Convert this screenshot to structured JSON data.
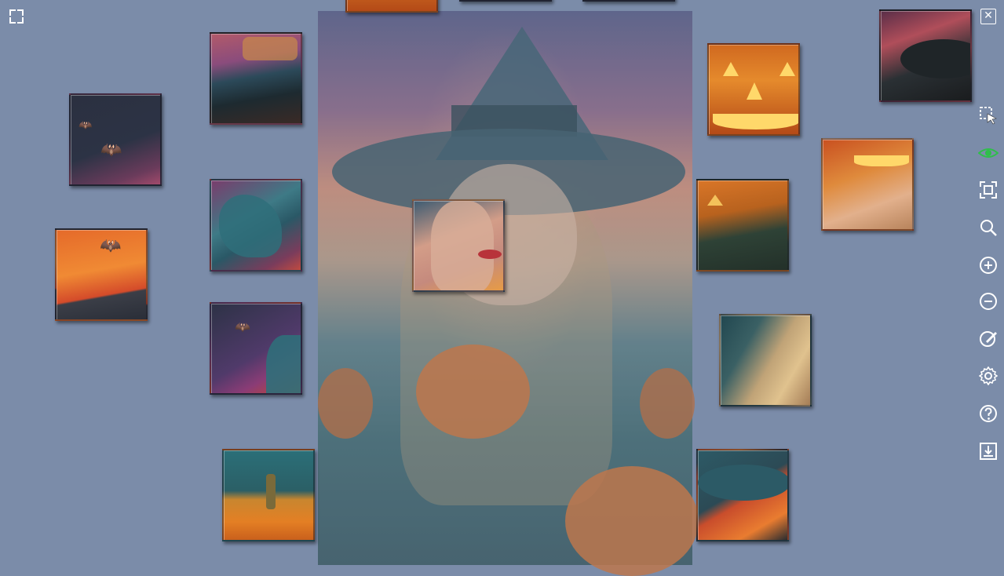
{
  "window": {
    "close_label": "✕"
  },
  "toolbar": {
    "buttons": [
      {
        "name": "select-pieces-button",
        "icon": "cursor-select-icon",
        "glyph": "⬚"
      },
      {
        "name": "preview-image-button",
        "icon": "eye-icon",
        "glyph": "◉",
        "color": "#2fbf4a"
      },
      {
        "name": "fit-to-screen-button",
        "icon": "frame-icon",
        "glyph": "⛶"
      },
      {
        "name": "search-button",
        "icon": "search-icon",
        "glyph": "⌕"
      },
      {
        "name": "zoom-in-button",
        "icon": "zoom-in-icon",
        "glyph": "⊕"
      },
      {
        "name": "zoom-out-button",
        "icon": "zoom-out-icon",
        "glyph": "⊖"
      },
      {
        "name": "background-color-button",
        "icon": "paint-brush-icon",
        "glyph": "✎"
      },
      {
        "name": "settings-button",
        "icon": "gear-icon",
        "glyph": "⚙"
      },
      {
        "name": "help-button",
        "icon": "help-icon",
        "glyph": "?"
      },
      {
        "name": "save-button",
        "icon": "download-icon",
        "glyph": "⤓"
      }
    ]
  },
  "colors": {
    "background": "#7b8ca9",
    "accent_eye": "#2fbf4a"
  },
  "puzzle": {
    "reference_image": "witch-with-pumpkins",
    "pieces_visible": 16
  }
}
